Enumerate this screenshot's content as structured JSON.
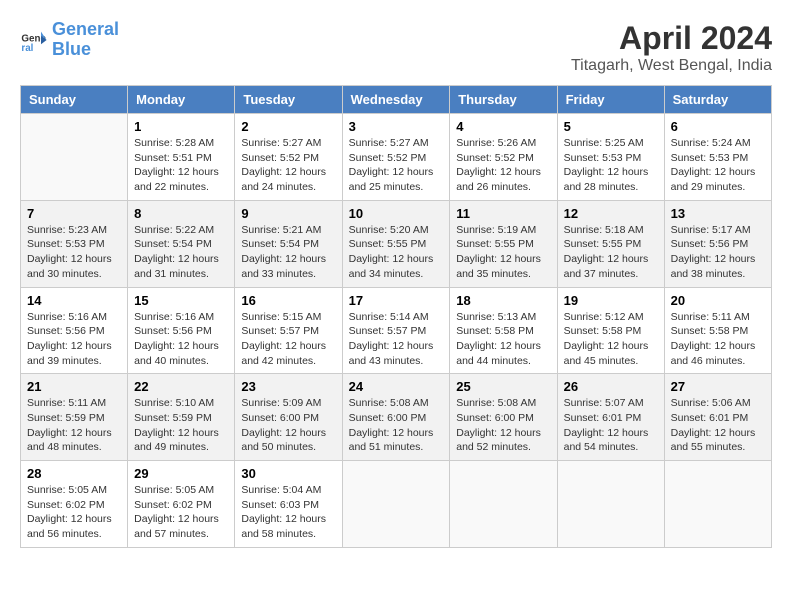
{
  "header": {
    "logo_line1": "General",
    "logo_line2": "Blue",
    "month_year": "April 2024",
    "location": "Titagarh, West Bengal, India"
  },
  "columns": [
    "Sunday",
    "Monday",
    "Tuesday",
    "Wednesday",
    "Thursday",
    "Friday",
    "Saturday"
  ],
  "weeks": [
    [
      {
        "day": "",
        "info": ""
      },
      {
        "day": "1",
        "info": "Sunrise: 5:28 AM\nSunset: 5:51 PM\nDaylight: 12 hours\nand 22 minutes."
      },
      {
        "day": "2",
        "info": "Sunrise: 5:27 AM\nSunset: 5:52 PM\nDaylight: 12 hours\nand 24 minutes."
      },
      {
        "day": "3",
        "info": "Sunrise: 5:27 AM\nSunset: 5:52 PM\nDaylight: 12 hours\nand 25 minutes."
      },
      {
        "day": "4",
        "info": "Sunrise: 5:26 AM\nSunset: 5:52 PM\nDaylight: 12 hours\nand 26 minutes."
      },
      {
        "day": "5",
        "info": "Sunrise: 5:25 AM\nSunset: 5:53 PM\nDaylight: 12 hours\nand 28 minutes."
      },
      {
        "day": "6",
        "info": "Sunrise: 5:24 AM\nSunset: 5:53 PM\nDaylight: 12 hours\nand 29 minutes."
      }
    ],
    [
      {
        "day": "7",
        "info": "Sunrise: 5:23 AM\nSunset: 5:53 PM\nDaylight: 12 hours\nand 30 minutes."
      },
      {
        "day": "8",
        "info": "Sunrise: 5:22 AM\nSunset: 5:54 PM\nDaylight: 12 hours\nand 31 minutes."
      },
      {
        "day": "9",
        "info": "Sunrise: 5:21 AM\nSunset: 5:54 PM\nDaylight: 12 hours\nand 33 minutes."
      },
      {
        "day": "10",
        "info": "Sunrise: 5:20 AM\nSunset: 5:55 PM\nDaylight: 12 hours\nand 34 minutes."
      },
      {
        "day": "11",
        "info": "Sunrise: 5:19 AM\nSunset: 5:55 PM\nDaylight: 12 hours\nand 35 minutes."
      },
      {
        "day": "12",
        "info": "Sunrise: 5:18 AM\nSunset: 5:55 PM\nDaylight: 12 hours\nand 37 minutes."
      },
      {
        "day": "13",
        "info": "Sunrise: 5:17 AM\nSunset: 5:56 PM\nDaylight: 12 hours\nand 38 minutes."
      }
    ],
    [
      {
        "day": "14",
        "info": "Sunrise: 5:16 AM\nSunset: 5:56 PM\nDaylight: 12 hours\nand 39 minutes."
      },
      {
        "day": "15",
        "info": "Sunrise: 5:16 AM\nSunset: 5:56 PM\nDaylight: 12 hours\nand 40 minutes."
      },
      {
        "day": "16",
        "info": "Sunrise: 5:15 AM\nSunset: 5:57 PM\nDaylight: 12 hours\nand 42 minutes."
      },
      {
        "day": "17",
        "info": "Sunrise: 5:14 AM\nSunset: 5:57 PM\nDaylight: 12 hours\nand 43 minutes."
      },
      {
        "day": "18",
        "info": "Sunrise: 5:13 AM\nSunset: 5:58 PM\nDaylight: 12 hours\nand 44 minutes."
      },
      {
        "day": "19",
        "info": "Sunrise: 5:12 AM\nSunset: 5:58 PM\nDaylight: 12 hours\nand 45 minutes."
      },
      {
        "day": "20",
        "info": "Sunrise: 5:11 AM\nSunset: 5:58 PM\nDaylight: 12 hours\nand 46 minutes."
      }
    ],
    [
      {
        "day": "21",
        "info": "Sunrise: 5:11 AM\nSunset: 5:59 PM\nDaylight: 12 hours\nand 48 minutes."
      },
      {
        "day": "22",
        "info": "Sunrise: 5:10 AM\nSunset: 5:59 PM\nDaylight: 12 hours\nand 49 minutes."
      },
      {
        "day": "23",
        "info": "Sunrise: 5:09 AM\nSunset: 6:00 PM\nDaylight: 12 hours\nand 50 minutes."
      },
      {
        "day": "24",
        "info": "Sunrise: 5:08 AM\nSunset: 6:00 PM\nDaylight: 12 hours\nand 51 minutes."
      },
      {
        "day": "25",
        "info": "Sunrise: 5:08 AM\nSunset: 6:00 PM\nDaylight: 12 hours\nand 52 minutes."
      },
      {
        "day": "26",
        "info": "Sunrise: 5:07 AM\nSunset: 6:01 PM\nDaylight: 12 hours\nand 54 minutes."
      },
      {
        "day": "27",
        "info": "Sunrise: 5:06 AM\nSunset: 6:01 PM\nDaylight: 12 hours\nand 55 minutes."
      }
    ],
    [
      {
        "day": "28",
        "info": "Sunrise: 5:05 AM\nSunset: 6:02 PM\nDaylight: 12 hours\nand 56 minutes."
      },
      {
        "day": "29",
        "info": "Sunrise: 5:05 AM\nSunset: 6:02 PM\nDaylight: 12 hours\nand 57 minutes."
      },
      {
        "day": "30",
        "info": "Sunrise: 5:04 AM\nSunset: 6:03 PM\nDaylight: 12 hours\nand 58 minutes."
      },
      {
        "day": "",
        "info": ""
      },
      {
        "day": "",
        "info": ""
      },
      {
        "day": "",
        "info": ""
      },
      {
        "day": "",
        "info": ""
      }
    ]
  ]
}
